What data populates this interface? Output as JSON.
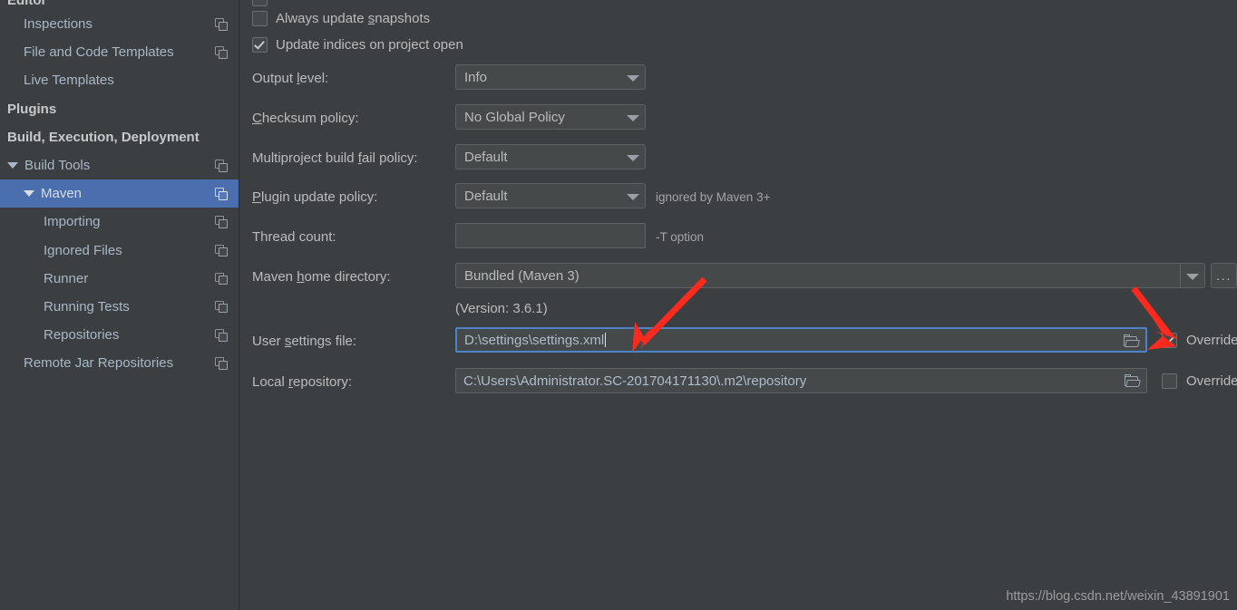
{
  "sidebar": {
    "items": [
      {
        "label": "Editor",
        "level": 0,
        "bold": true,
        "selected": false,
        "arrow": "none",
        "copy_icon": false,
        "cut_top": true
      },
      {
        "label": "Inspections",
        "level": 1,
        "bold": false,
        "selected": false,
        "arrow": "none",
        "copy_icon": true
      },
      {
        "label": "File and Code Templates",
        "level": 1,
        "bold": false,
        "selected": false,
        "arrow": "none",
        "copy_icon": true
      },
      {
        "label": "Live Templates",
        "level": 1,
        "bold": false,
        "selected": false,
        "arrow": "none",
        "copy_icon": false
      },
      {
        "label": "Plugins",
        "level": 0,
        "bold": true,
        "selected": false,
        "arrow": "none",
        "copy_icon": false
      },
      {
        "label": "Build, Execution, Deployment",
        "level": 0,
        "bold": true,
        "selected": false,
        "arrow": "none",
        "copy_icon": false
      },
      {
        "label": "Build Tools",
        "level": 0,
        "bold": false,
        "selected": false,
        "arrow": "expanded",
        "copy_icon": true
      },
      {
        "label": "Maven",
        "level": 1,
        "bold": false,
        "selected": true,
        "arrow": "expanded",
        "copy_icon": true
      },
      {
        "label": "Importing",
        "level": 2,
        "bold": false,
        "selected": false,
        "arrow": "none",
        "copy_icon": true
      },
      {
        "label": "Ignored Files",
        "level": 2,
        "bold": false,
        "selected": false,
        "arrow": "none",
        "copy_icon": true
      },
      {
        "label": "Runner",
        "level": 2,
        "bold": false,
        "selected": false,
        "arrow": "none",
        "copy_icon": true
      },
      {
        "label": "Running Tests",
        "level": 2,
        "bold": false,
        "selected": false,
        "arrow": "none",
        "copy_icon": true
      },
      {
        "label": "Repositories",
        "level": 2,
        "bold": false,
        "selected": false,
        "arrow": "none",
        "copy_icon": true
      },
      {
        "label": "Remote Jar Repositories",
        "level": 1,
        "bold": false,
        "selected": false,
        "arrow": "none",
        "copy_icon": true
      }
    ]
  },
  "main": {
    "checkboxes": [
      {
        "label": "Always update snapshots",
        "mnemonic": "s",
        "checked": false
      },
      {
        "label": "Update indices on project open",
        "mnemonic": "",
        "checked": true
      }
    ],
    "fields": {
      "output_level": {
        "label": "Output level:",
        "mnemonic": "l",
        "value": "Info"
      },
      "checksum_policy": {
        "label": "Checksum policy:",
        "mnemonic": "C",
        "value": "No Global Policy"
      },
      "multiproject_fail_policy": {
        "label": "Multiproject build fail policy:",
        "mnemonic": "f",
        "value": "Default"
      },
      "plugin_update_policy": {
        "label": "Plugin update policy:",
        "mnemonic": "P",
        "value": "Default",
        "hint": "ignored by Maven 3+"
      },
      "thread_count": {
        "label": "Thread count:",
        "mnemonic": "",
        "value": "",
        "hint": "-T option"
      },
      "maven_home": {
        "label": "Maven home directory:",
        "mnemonic": "h",
        "value": "Bundled (Maven 3)",
        "version_note": "(Version: 3.6.1)",
        "browse_label": "..."
      },
      "user_settings_file": {
        "label": "User settings file:",
        "mnemonic": "s",
        "value": "D:\\settings\\settings.xml",
        "override_label": "Override",
        "override_checked": true,
        "focused": true
      },
      "local_repository": {
        "label": "Local repository:",
        "mnemonic": "r",
        "value": "C:\\Users\\Administrator.SC-201704171130\\.m2\\repository",
        "override_label": "Override",
        "override_checked": false,
        "focused": false
      }
    }
  },
  "watermark": {
    "text": "https://blog.csdn.net/weixin_43891901"
  },
  "colors": {
    "background": "#3c3f41",
    "selection": "#4b6eaf",
    "text": "#bbbbbb",
    "field_bg": "#45494a",
    "focus_border": "#4d84c8",
    "annotation_red": "#fa2a1e"
  }
}
